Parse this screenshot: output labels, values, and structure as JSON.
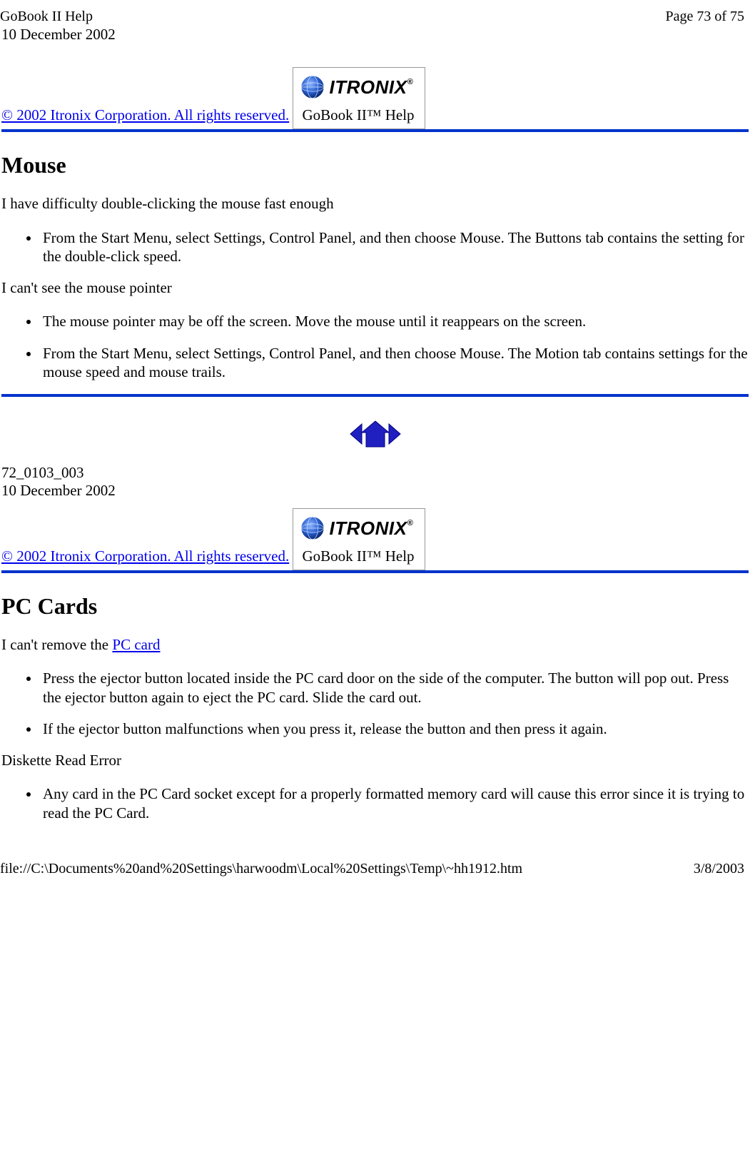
{
  "header": {
    "left": "GoBook II Help",
    "right": "Page 73 of 75"
  },
  "dateline1": "10 December 2002",
  "copyright": "© 2002 Itronix Corporation.  All rights reserved.",
  "logo": {
    "text": "ITRONIX",
    "sub": "GoBook II™ Help"
  },
  "section_mouse": {
    "heading": "Mouse",
    "q1": "I have difficulty double-clicking the mouse fast enough",
    "a1": "From the Start Menu, select Settings, Control Panel, and then choose Mouse.  The Buttons tab contains the setting for the double-click speed.",
    "q2": "I can't see the mouse pointer",
    "a2a": "The mouse pointer may be off the screen. Move the mouse until it reappears on the screen.",
    "a2b": "From the Start Menu, select Settings, Control Panel, and then choose Mouse.  The Motion tab contains settings for the mouse speed and mouse trails."
  },
  "doc_id": "72_0103_003",
  "dateline2": "10 December 2002",
  "section_pc": {
    "heading": "PC Cards",
    "q1_prefix": "I can't remove the ",
    "q1_link": "PC card",
    "a1a": "Press the ejector button located inside the PC card door on the side of the computer. The button will pop out. Press the ejector button again to eject the PC card.  Slide the card out.",
    "a1b": "If the ejector button malfunctions when you press it, release the button and then press it again.",
    "q2": "Diskette Read Error",
    "a2": "Any card in the PC Card socket except for a properly formatted memory card will cause this error since it is trying to read the PC Card."
  },
  "footer": {
    "path": "file://C:\\Documents%20and%20Settings\\harwoodm\\Local%20Settings\\Temp\\~hh1912.htm",
    "date": "3/8/2003"
  }
}
